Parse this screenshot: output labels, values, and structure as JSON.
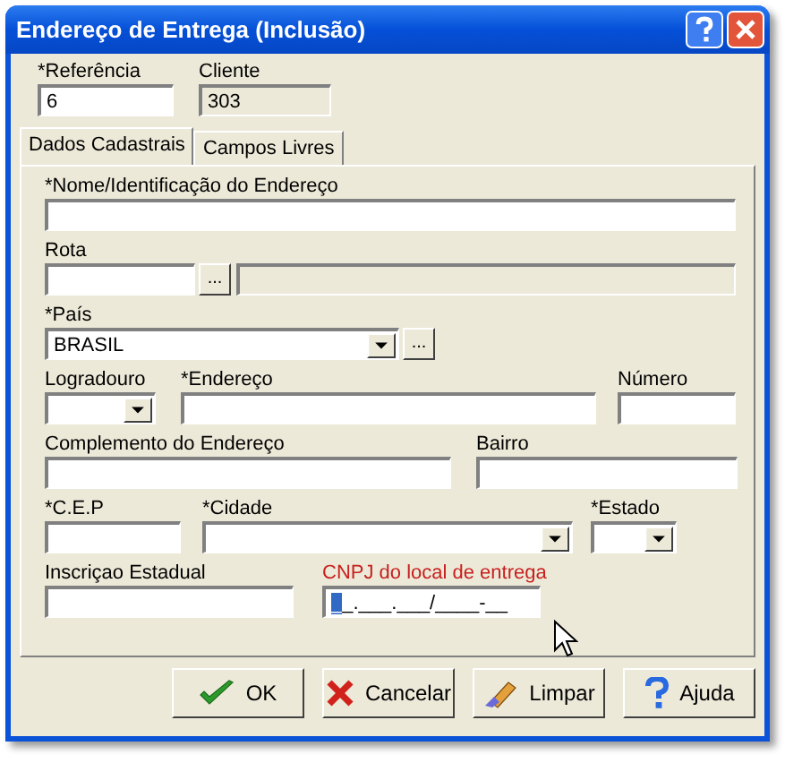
{
  "window": {
    "title": "Endereço de Entrega (Inclusão)"
  },
  "header_fields": [
    {
      "label": "*Referência",
      "value": "6",
      "disabled": false
    },
    {
      "label": "Cliente",
      "value": "303",
      "disabled": true
    }
  ],
  "tabs": [
    {
      "label": "Dados Cadastrais",
      "selected": true
    },
    {
      "label": "Campos Livres",
      "selected": false
    }
  ],
  "rows": [
    [
      {
        "kind": "text",
        "label": "*Nome/Identificação do Endereço"
      }
    ],
    [
      {
        "kind": "lookup",
        "label": "Rota",
        "button": "..."
      }
    ],
    [
      {
        "kind": "combo_lookup",
        "label": "*País",
        "value": "BRASIL",
        "button": "..."
      }
    ],
    [
      {
        "kind": "combo",
        "label": "Logradouro"
      },
      {
        "kind": "text",
        "label": "*Endereço"
      },
      {
        "kind": "text",
        "label": "Número"
      }
    ],
    [
      {
        "kind": "text",
        "label": "Complemento do Endereço"
      },
      {
        "kind": "text",
        "label": "Bairro"
      }
    ],
    [
      {
        "kind": "text",
        "label": "*C.E.P"
      },
      {
        "kind": "combo",
        "label": "*Cidade"
      },
      {
        "kind": "combo",
        "label": "*Estado"
      }
    ],
    [
      {
        "kind": "text",
        "label": "Inscriçao Estadual"
      },
      {
        "kind": "mask",
        "label": "CNPJ do local de entrega",
        "highlighted": true,
        "value": "__.___.___/____-__"
      }
    ]
  ],
  "buttons": [
    {
      "kind": "ok",
      "label": "OK"
    },
    {
      "kind": "cancel",
      "label": "Cancelar"
    },
    {
      "kind": "clear",
      "label": "Limpar"
    },
    {
      "kind": "help",
      "label": "Ajuda"
    }
  ]
}
